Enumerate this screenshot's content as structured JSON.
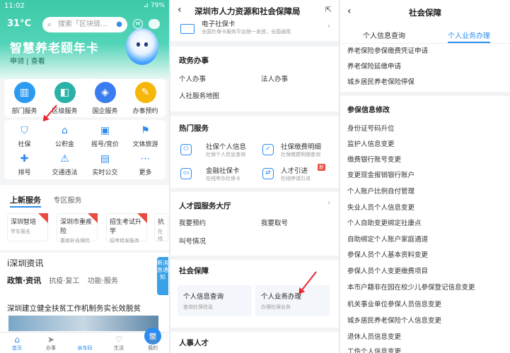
{
  "panel1": {
    "status_time": "11:02",
    "status_right": "⊿ 79%",
    "temperature": "31°C",
    "search_placeholder": "搜索「区块链…",
    "banner_title": "智慧养老颐年卡",
    "banner_sub": "申领 | 查看",
    "main_services": [
      "部门服务",
      "区级服务",
      "国企服务",
      "办事预约"
    ],
    "small_services": [
      "社保",
      "公积金",
      "摇号/竞价",
      "文体旅游",
      "排号",
      "交通违法",
      "实时公交",
      "更多"
    ],
    "tab_active": "上新服务",
    "tab_other": "专区服务",
    "service_cards": [
      {
        "title": "深圳智培",
        "sub": "学车报名"
      },
      {
        "title": "深圳市重疾险",
        "sub": "重疾补充保险"
      },
      {
        "title": "招生考试升学",
        "sub": "招考转发服务"
      },
      {
        "title": "抗",
        "sub": "在线"
      }
    ],
    "news_header": "i深圳资讯",
    "news_tabs": [
      "政策·资讯",
      "抗疫·复工",
      "功能·服务"
    ],
    "news_title": "深圳建立健全扶贫工作机制务实长效脱贫",
    "side_tag": "新消息通知",
    "tabbar": [
      "首页",
      "办事",
      "亲车码",
      "生活",
      "我的"
    ]
  },
  "panel2": {
    "title": "深圳市人力资源和社会保障局",
    "ecard_title": "电子社保卡",
    "ecard_sub": "全国社保卡服务平台统一发放，全国通用",
    "sec_gov": "政务办事",
    "gov_items": [
      "个人办事",
      "法人办事",
      "人社服务地图"
    ],
    "sec_hot": "热门服务",
    "hot_items": [
      {
        "title": "社保个人信息",
        "sub": "社保个人信息查询"
      },
      {
        "title": "社保缴费明细",
        "sub": "社保缴费明细查询"
      },
      {
        "title": "金融社保卡",
        "sub": "在线申办社保卡"
      },
      {
        "title": "人才引进",
        "sub": "在线申请引进",
        "badge": "新"
      }
    ],
    "sec_talent": "人才园服务大厅",
    "talent_items": [
      "我要预约",
      "我要取号",
      "叫号情况"
    ],
    "sec_social": "社会保障",
    "social_items": [
      {
        "title": "个人信息查询",
        "sub": "查询社保信息"
      },
      {
        "title": "个人业务办理",
        "sub": "办理社保业务"
      }
    ],
    "sec_hr": "人事人才"
  },
  "panel3": {
    "title": "社会保障",
    "tabs": [
      "个人信息查询",
      "个人业务办理"
    ],
    "top_items": [
      "养老保险参保缴费凭证申请",
      "养老保险延缴申请",
      "城乡居民养老保险停保"
    ],
    "section": "参保信息修改",
    "items": [
      "身份证号码升位",
      "监护人信息变更",
      "缴费银行账号变更",
      "变更现金报销银行账户",
      "个人账户比例自付管理",
      "失业人员个人信息变更",
      "个人自助变更绑定社康点",
      "自助绑定个人账户家庭通道",
      "参保人员个人基本资料变更",
      "参保人员个人变更缴费项目",
      "本市户籍非在园在校少儿参保登记信息变更",
      "机关事业单位参保人员信息变更",
      "城乡居民养老保险个人信息变更",
      "退休人员信息变更",
      "工伤个人信息变更"
    ]
  },
  "colors": {
    "accent": "#2d8cf0",
    "green": "#3cc9a8",
    "arrow": "#e8262f"
  }
}
